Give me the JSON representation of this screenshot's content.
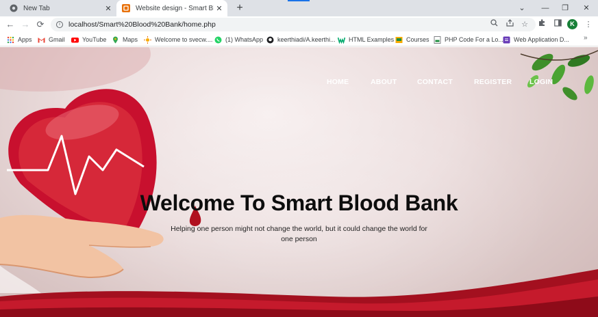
{
  "browser": {
    "tabs": [
      {
        "title": "New Tab",
        "active": false
      },
      {
        "title": "Website design - Smart Blood Ba",
        "active": true
      }
    ],
    "new_tab": "+",
    "window_controls": {
      "minimize": "—",
      "restore": "❐",
      "close": "✕",
      "dropdown": "⌄"
    },
    "url": "localhost/Smart%20Blood%20Bank/home.php",
    "avatar_initial": "K",
    "bookmarks": [
      {
        "label": "Apps",
        "icon": "apps-grid-icon",
        "color": "#ea4335"
      },
      {
        "label": "Gmail",
        "icon": "gmail-icon",
        "color": "#ea4335"
      },
      {
        "label": "YouTube",
        "icon": "youtube-icon",
        "color": "#ff0000"
      },
      {
        "label": "Maps",
        "icon": "maps-pin-icon",
        "color": "#34a853"
      },
      {
        "label": "Welcome to svecw....",
        "icon": "svecw-icon",
        "color": "#f9ab00"
      },
      {
        "label": "(1) WhatsApp",
        "icon": "whatsapp-icon",
        "color": "#25d366"
      },
      {
        "label": "keerthiadi/A.keerthi...",
        "icon": "github-icon",
        "color": "#202124"
      },
      {
        "label": "HTML Examples",
        "icon": "w3schools-icon",
        "color": "#04aa6d"
      },
      {
        "label": "Courses",
        "icon": "courses-icon",
        "color": "#f9ab00"
      },
      {
        "label": "PHP Code For a Lo...",
        "icon": "php-page-icon",
        "color": "#5f6368"
      },
      {
        "label": "Web Application D...",
        "icon": "web-app-icon",
        "color": "#673ab7"
      }
    ],
    "bookmarks_more": "»"
  },
  "page": {
    "nav": [
      "HOME",
      "ABOUT",
      "CONTACT",
      "REGISTER",
      "LOGIN"
    ],
    "headline": "Welcome To Smart Blood Bank",
    "tagline": "Helping one person might not change the world, but it could change the world for one person"
  },
  "colors": {
    "heart": "#c8102e",
    "nav_text": "#ffffff",
    "headline": "#0d0d0d",
    "accent_blue": "#1a73e8"
  }
}
